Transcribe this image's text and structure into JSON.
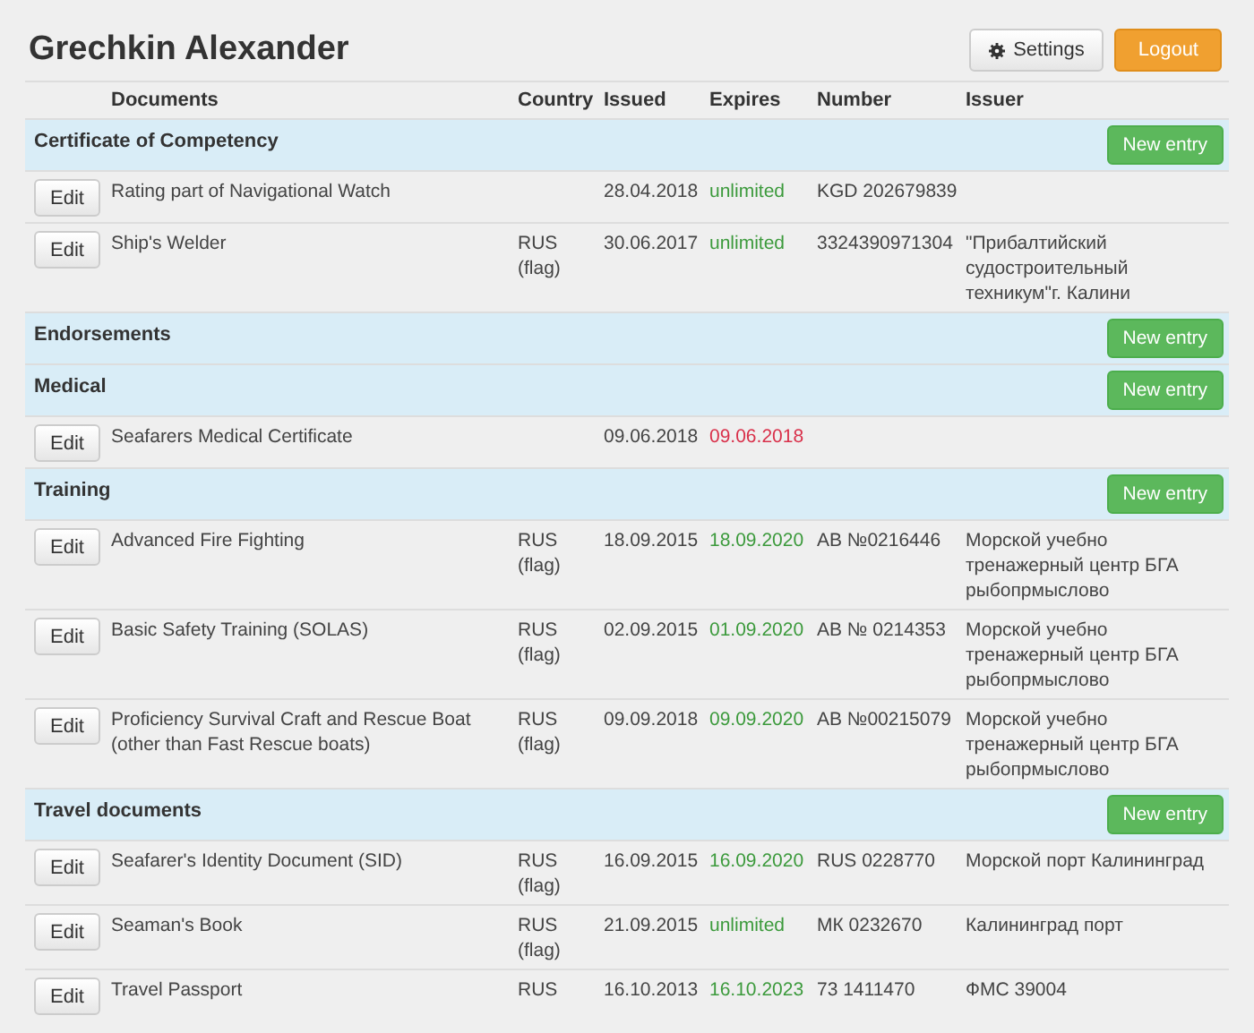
{
  "header": {
    "title": "Grechkin Alexander",
    "settings": "Settings",
    "logout": "Logout"
  },
  "columns": [
    "Documents",
    "Country",
    "Issued",
    "Expires",
    "Number",
    "Issuer"
  ],
  "sections": [
    {
      "title": "Certificate of Competency",
      "button": "New entry",
      "rows": [
        {
          "edit": "Edit",
          "document": "Rating part of Navigational Watch",
          "issued": "28.04.2018",
          "expires": "unlimited",
          "expired": false,
          "number": "KGD 202679839"
        },
        {
          "edit": "Edit",
          "document": "Ship's Welder",
          "country": "RUS (flag)",
          "issued": "30.06.2017",
          "expires": "unlimited",
          "expired": false,
          "number": "3324390971304",
          "issuer": "\"Прибалтийский судостроительный техникум\"г. Калини"
        }
      ]
    },
    {
      "title": "Endorsements",
      "button": "New entry"
    },
    {
      "title": "Medical",
      "button": "New entry",
      "rows": [
        {
          "edit": "Edit",
          "document": "Seafarers Medical Certificate",
          "issued": "09.06.2018",
          "expires": "09.06.2018",
          "expired": true
        }
      ]
    },
    {
      "title": "Training",
      "button": "New entry",
      "rows": [
        {
          "edit": "Edit",
          "document": "Advanced Fire Fighting",
          "country": "RUS (flag)",
          "issued": "18.09.2015",
          "expires": "18.09.2020",
          "expired": false,
          "number": "АВ №0216446",
          "issuer": "Морской учебно тренажерный центр БГА рыбопрмыслово"
        },
        {
          "edit": "Edit",
          "document": "Basic Safety Training (SOLAS)",
          "country": "RUS (flag)",
          "issued": "02.09.2015",
          "expires": "01.09.2020",
          "expired": false,
          "number": "АВ № 0214353",
          "issuer": "Морской учебно тренажерный центр БГА рыбопрмыслово"
        },
        {
          "edit": "Edit",
          "document": "Proficiency Survival Craft and Rescue Boat (other than Fast Rescue boats)",
          "country": "RUS (flag)",
          "issued": "09.09.2018",
          "expires": "09.09.2020",
          "expired": false,
          "number": "АВ №00215079",
          "issuer": "Морской учебно тренажерный центр БГА рыбопрмыслово"
        }
      ]
    },
    {
      "title": "Travel documents",
      "button": "New entry",
      "rows": [
        {
          "edit": "Edit",
          "document": "Seafarer's Identity Document (SID)",
          "country": "RUS (flag)",
          "issued": "16.09.2015",
          "expires": "16.09.2020",
          "expired": false,
          "number": "RUS 0228770",
          "issuer": "Морской порт Калининград"
        },
        {
          "edit": "Edit",
          "document": "Seaman's Book",
          "country": "RUS (flag)",
          "issued": "21.09.2015",
          "expires": "unlimited",
          "expired": false,
          "number": "МК 0232670",
          "issuer": "Калининград порт"
        },
        {
          "edit": "Edit",
          "document": "Travel Passport",
          "country": "RUS",
          "issued": "16.10.2013",
          "expires": "16.10.2023",
          "expired": false,
          "number": "73 1411470",
          "issuer": "ФМС 39004"
        }
      ]
    }
  ]
}
